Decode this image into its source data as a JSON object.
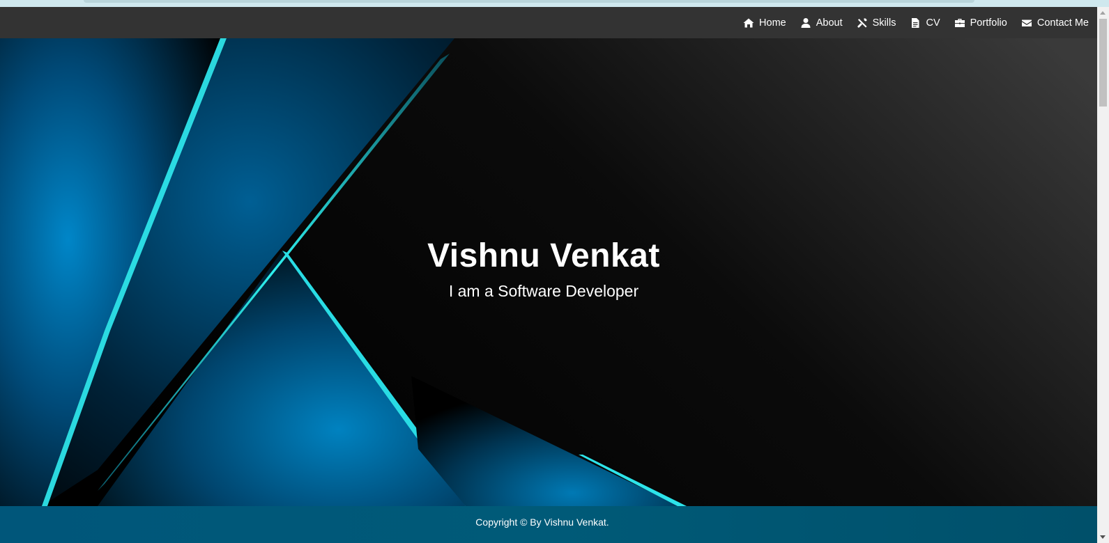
{
  "nav": {
    "items": [
      {
        "label": "Home",
        "icon": "home-icon"
      },
      {
        "label": "About",
        "icon": "user-icon"
      },
      {
        "label": "Skills",
        "icon": "tools-icon"
      },
      {
        "label": "CV",
        "icon": "file-icon"
      },
      {
        "label": "Portfolio",
        "icon": "briefcase-icon"
      },
      {
        "label": "Contact Me",
        "icon": "envelope-icon"
      }
    ]
  },
  "hero": {
    "name": "Vishnu Venkat",
    "tagline": "I am a Software Developer"
  },
  "footer": {
    "copyright": "Copyright © By Vishnu Venkat."
  },
  "colors": {
    "navbar": "#333333",
    "footer": "#005a78",
    "accent": "#2ee6e6",
    "blue": "#0078b8"
  }
}
